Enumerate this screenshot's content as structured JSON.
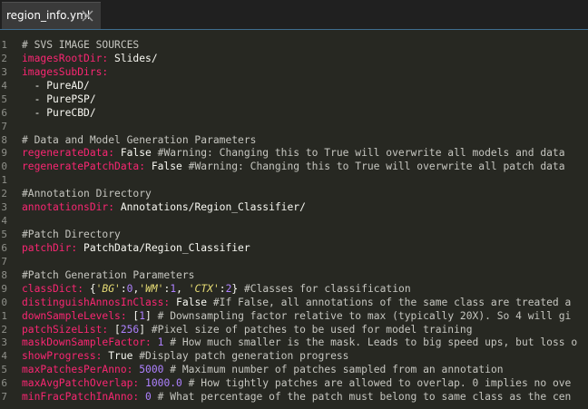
{
  "tab": {
    "filename": "region_info.yml"
  },
  "icons": {
    "close": "close-icon"
  },
  "colors": {
    "background": "#272822",
    "tab_active": "#3a3a3a",
    "key": "#f92672",
    "comment": "#c6c6c0",
    "number": "#ae81ff",
    "string": "#e6db74",
    "text": "#f8f8f2",
    "line_number": "#8f908a"
  },
  "lines": [
    {
      "n": "1",
      "parts": [
        {
          "t": "# SVS IMAGE SOURCES",
          "c": "comment"
        }
      ]
    },
    {
      "n": "2",
      "parts": [
        {
          "t": "imagesRootDir:",
          "c": "key"
        },
        {
          "t": " Slides/",
          "c": "val"
        }
      ]
    },
    {
      "n": "3",
      "parts": [
        {
          "t": "imagesSubDirs:",
          "c": "key"
        }
      ]
    },
    {
      "n": "4",
      "parts": [
        {
          "t": "  - PureAD/",
          "c": "val"
        }
      ]
    },
    {
      "n": "5",
      "parts": [
        {
          "t": "  - PurePSP/",
          "c": "val"
        }
      ]
    },
    {
      "n": "6",
      "parts": [
        {
          "t": "  - PureCBD/",
          "c": "val"
        }
      ]
    },
    {
      "n": "7",
      "parts": []
    },
    {
      "n": "8",
      "parts": [
        {
          "t": "# Data and Model Generation Parameters",
          "c": "comment"
        }
      ]
    },
    {
      "n": "9",
      "parts": [
        {
          "t": "regenerateData:",
          "c": "key"
        },
        {
          "t": " False ",
          "c": "val"
        },
        {
          "t": "#Warning: Changing this to True will overwrite all models and data",
          "c": "comment"
        }
      ]
    },
    {
      "n": "0",
      "parts": [
        {
          "t": "regeneratePatchData:",
          "c": "key"
        },
        {
          "t": " False ",
          "c": "val"
        },
        {
          "t": "#Warning: Changing this to True will overwrite all patch data",
          "c": "comment"
        }
      ]
    },
    {
      "n": "1",
      "parts": []
    },
    {
      "n": "2",
      "parts": [
        {
          "t": "#Annotation Directory",
          "c": "comment"
        }
      ]
    },
    {
      "n": "3",
      "parts": [
        {
          "t": "annotationsDir:",
          "c": "key"
        },
        {
          "t": " Annotations/Region_Classifier/",
          "c": "val"
        }
      ]
    },
    {
      "n": "4",
      "parts": []
    },
    {
      "n": "5",
      "parts": [
        {
          "t": "#Patch Directory",
          "c": "comment"
        }
      ]
    },
    {
      "n": "6",
      "parts": [
        {
          "t": "patchDir:",
          "c": "key"
        },
        {
          "t": " PatchData/Region_Classifier",
          "c": "val"
        }
      ]
    },
    {
      "n": "7",
      "parts": []
    },
    {
      "n": "8",
      "parts": [
        {
          "t": "#Patch Generation Parameters",
          "c": "comment"
        }
      ]
    },
    {
      "n": "9",
      "parts": [
        {
          "t": "classDict:",
          "c": "key"
        },
        {
          "t": " {",
          "c": "val"
        },
        {
          "t": "'BG'",
          "c": "str"
        },
        {
          "t": ":",
          "c": "val"
        },
        {
          "t": "0",
          "c": "num"
        },
        {
          "t": ",",
          "c": "val"
        },
        {
          "t": "'WM'",
          "c": "str"
        },
        {
          "t": ":",
          "c": "val"
        },
        {
          "t": "1",
          "c": "num"
        },
        {
          "t": ", ",
          "c": "val"
        },
        {
          "t": "'CTX'",
          "c": "str"
        },
        {
          "t": ":",
          "c": "val"
        },
        {
          "t": "2",
          "c": "num"
        },
        {
          "t": "} ",
          "c": "val"
        },
        {
          "t": "#Classes for classification",
          "c": "comment"
        }
      ]
    },
    {
      "n": "0",
      "parts": [
        {
          "t": "distinguishAnnosInClass:",
          "c": "key"
        },
        {
          "t": " False ",
          "c": "val"
        },
        {
          "t": "#If False, all annotations of the same class are treated a",
          "c": "comment"
        }
      ]
    },
    {
      "n": "1",
      "parts": [
        {
          "t": "downSampleLevels:",
          "c": "key"
        },
        {
          "t": " [",
          "c": "val"
        },
        {
          "t": "1",
          "c": "num"
        },
        {
          "t": "] ",
          "c": "val"
        },
        {
          "t": "# Downsampling factor relative to max (typically 20X). So 4 will gi",
          "c": "comment"
        }
      ]
    },
    {
      "n": "2",
      "parts": [
        {
          "t": "patchSizeList:",
          "c": "key"
        },
        {
          "t": " [",
          "c": "val"
        },
        {
          "t": "256",
          "c": "num"
        },
        {
          "t": "] ",
          "c": "val"
        },
        {
          "t": "#Pixel size of patches to be used for model training",
          "c": "comment"
        }
      ]
    },
    {
      "n": "3",
      "parts": [
        {
          "t": "maskDownSampleFactor:",
          "c": "key"
        },
        {
          "t": " ",
          "c": "val"
        },
        {
          "t": "1",
          "c": "num"
        },
        {
          "t": " ",
          "c": "val"
        },
        {
          "t": "# How much smaller is the mask. Leads to big speed ups, but loss o",
          "c": "comment"
        }
      ]
    },
    {
      "n": "4",
      "parts": [
        {
          "t": "showProgress:",
          "c": "key"
        },
        {
          "t": " True ",
          "c": "val"
        },
        {
          "t": "#Display patch generation progress",
          "c": "comment"
        }
      ]
    },
    {
      "n": "5",
      "parts": [
        {
          "t": "maxPatchesPerAnno:",
          "c": "key"
        },
        {
          "t": " ",
          "c": "val"
        },
        {
          "t": "5000",
          "c": "num"
        },
        {
          "t": " ",
          "c": "val"
        },
        {
          "t": "# Maximum number of patches sampled from an annotation",
          "c": "comment"
        }
      ]
    },
    {
      "n": "6",
      "parts": [
        {
          "t": "maxAvgPatchOverlap:",
          "c": "key"
        },
        {
          "t": " ",
          "c": "val"
        },
        {
          "t": "1000.0",
          "c": "num"
        },
        {
          "t": " ",
          "c": "val"
        },
        {
          "t": "# How tightly patches are allowed to overlap. 0 implies no ove",
          "c": "comment"
        }
      ]
    },
    {
      "n": "7",
      "parts": [
        {
          "t": "minFracPatchInAnno:",
          "c": "key"
        },
        {
          "t": " ",
          "c": "val"
        },
        {
          "t": "0",
          "c": "num"
        },
        {
          "t": " ",
          "c": "val"
        },
        {
          "t": "# What percentage of the patch must belong to same class as the cen",
          "c": "comment"
        }
      ]
    }
  ]
}
